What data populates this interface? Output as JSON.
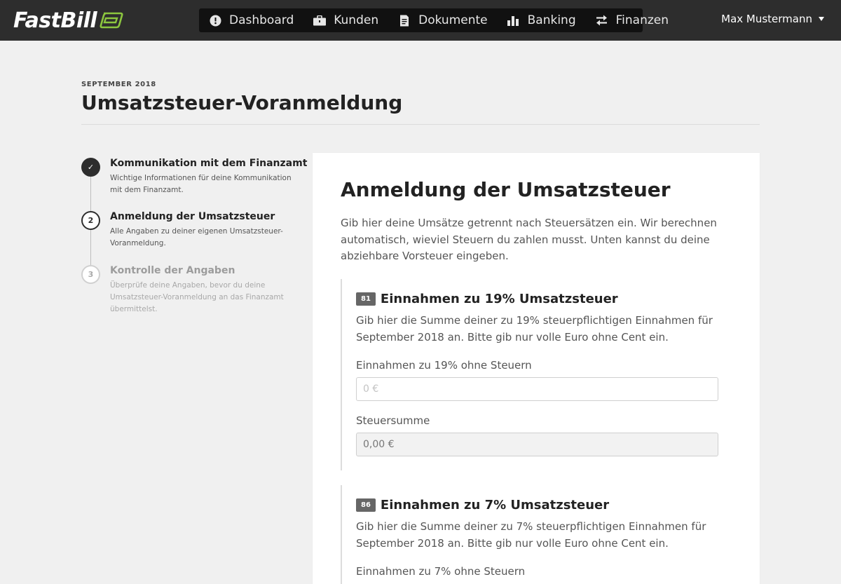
{
  "app": {
    "logo_text": "FastBill",
    "nav": [
      {
        "label": "Dashboard",
        "icon": "dashboard-icon"
      },
      {
        "label": "Kunden",
        "icon": "briefcase-icon"
      },
      {
        "label": "Dokumente",
        "icon": "document-icon"
      },
      {
        "label": "Banking",
        "icon": "bar-chart-icon"
      },
      {
        "label": "Finanzen",
        "icon": "transfer-arrows-icon"
      }
    ],
    "user_name": "Max Mustermann"
  },
  "header": {
    "period": "SEPTEMBER 2018",
    "title": "Umsatzsteuer-Voranmeldung"
  },
  "steps": [
    {
      "marker": "✓",
      "state": "done",
      "title": "Kommunikation mit dem Finanzamt",
      "description": "Wichtige Informationen für deine Kommunikation mit dem Finanzamt."
    },
    {
      "marker": "2",
      "state": "active",
      "title": "Anmeldung der Umsatzsteuer",
      "description": "Alle Angaben zu deiner eigenen Umsatzsteuer-Voranmeldung."
    },
    {
      "marker": "3",
      "state": "todo",
      "title": "Kontrolle der Angaben",
      "description": "Überprüfe deine Angaben, bevor du deine Umsatzsteuer-Voranmeldung an das Finanzamt übermittelst."
    }
  ],
  "card": {
    "title": "Anmeldung der Umsatzsteuer",
    "intro": "Gib hier deine Umsätze getrennt nach Steuersätzen ein. Wir berechnen automatisch, wieviel Steuern du zahlen musst. Unten kannst du deine abziehbare Vorsteuer eingeben.",
    "sections": [
      {
        "badge": "81",
        "title": "Einnahmen zu 19% Umsatzsteuer",
        "description": "Gib hier die Summe deiner zu 19% steuerpflichtigen Einnahmen für September 2018 an. Bitte gib nur volle Euro ohne Cent ein.",
        "input_label": "Einnahmen zu 19% ohne Steuern",
        "input_placeholder": "0 €",
        "input_value": "",
        "sum_label": "Steuersumme",
        "sum_value": "0,00 €"
      },
      {
        "badge": "86",
        "title": "Einnahmen zu 7% Umsatzsteuer",
        "description": "Gib hier die Summe deiner zu 7% steuerpflichtigen Einnahmen für September 2018 an. Bitte gib nur volle Euro ohne Cent ein.",
        "input_label": "Einnahmen zu 7% ohne Steuern"
      }
    ]
  },
  "colors": {
    "topbar": "#2d2d2d",
    "nav_background": "#111111",
    "page_background": "#f0f0f0",
    "logo_accent": "#8cc63f"
  }
}
